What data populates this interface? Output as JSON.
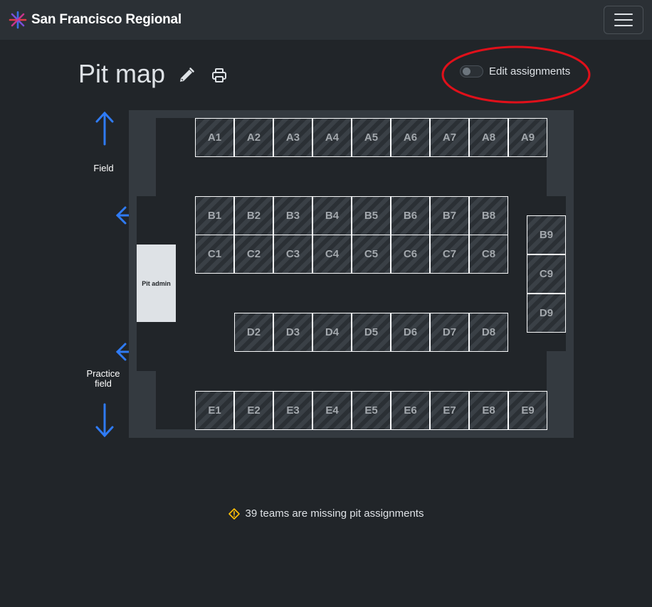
{
  "navbar": {
    "brand": "San Francisco Regional",
    "brand_logo_icon": "star-burst-logo",
    "menu_icon": "hamburger-icon"
  },
  "header": {
    "title": "Pit map",
    "edit_icon": "pencil-icon",
    "print_icon": "printer-icon"
  },
  "edit_toggle": {
    "label": "Edit assignments",
    "checked": false,
    "highlight_color": "#e0101a"
  },
  "map": {
    "field_label": "Field",
    "practice_label": "Practice\nfield",
    "pit_admin_label": "Pit admin",
    "arrow_color": "#2f7bf5",
    "pits": {
      "row_a": [
        "A1",
        "A2",
        "A3",
        "A4",
        "A5",
        "A6",
        "A7",
        "A8",
        "A9"
      ],
      "row_b": [
        "B1",
        "B2",
        "B3",
        "B4",
        "B5",
        "B6",
        "B7",
        "B8"
      ],
      "row_c": [
        "C1",
        "C2",
        "C3",
        "C4",
        "C5",
        "C6",
        "C7",
        "C8"
      ],
      "column_9": [
        "B9",
        "C9",
        "D9"
      ],
      "row_d": [
        "D2",
        "D3",
        "D4",
        "D5",
        "D6",
        "D7",
        "D8"
      ],
      "row_e": [
        "E1",
        "E2",
        "E3",
        "E4",
        "E5",
        "E6",
        "E7",
        "E8",
        "E9"
      ]
    }
  },
  "warning": {
    "icon": "warning-diamond-icon",
    "text": "39 teams are missing pit assignments",
    "color": "#ffc107"
  }
}
